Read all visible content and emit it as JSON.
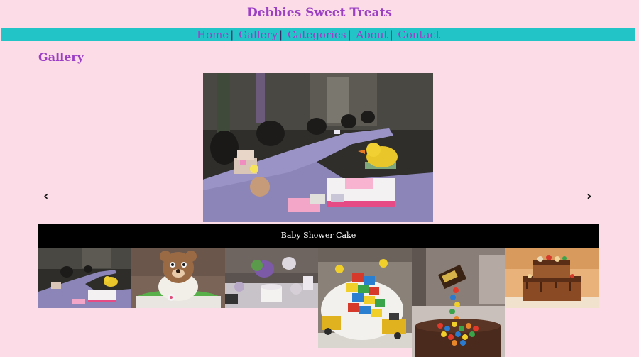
{
  "site": {
    "title": "Debbies Sweet Treats"
  },
  "nav": {
    "items": [
      {
        "label": "Home"
      },
      {
        "label": "Gallery"
      },
      {
        "label": "Categories"
      },
      {
        "label": "About"
      },
      {
        "label": "Contact"
      }
    ],
    "separator": "|"
  },
  "page": {
    "heading": "Gallery"
  },
  "slideshow": {
    "caption": "Baby Shower Cake",
    "prev_label": "‹",
    "next_label": "›",
    "active_index": 0
  },
  "thumbnails": [
    {
      "id": "baby-shower-cake"
    },
    {
      "id": "teddy-bear-cake"
    },
    {
      "id": "dessert-table"
    },
    {
      "id": "lego-cake"
    },
    {
      "id": "mm-candy-cake"
    },
    {
      "id": "chocolate-drip-cake"
    }
  ]
}
